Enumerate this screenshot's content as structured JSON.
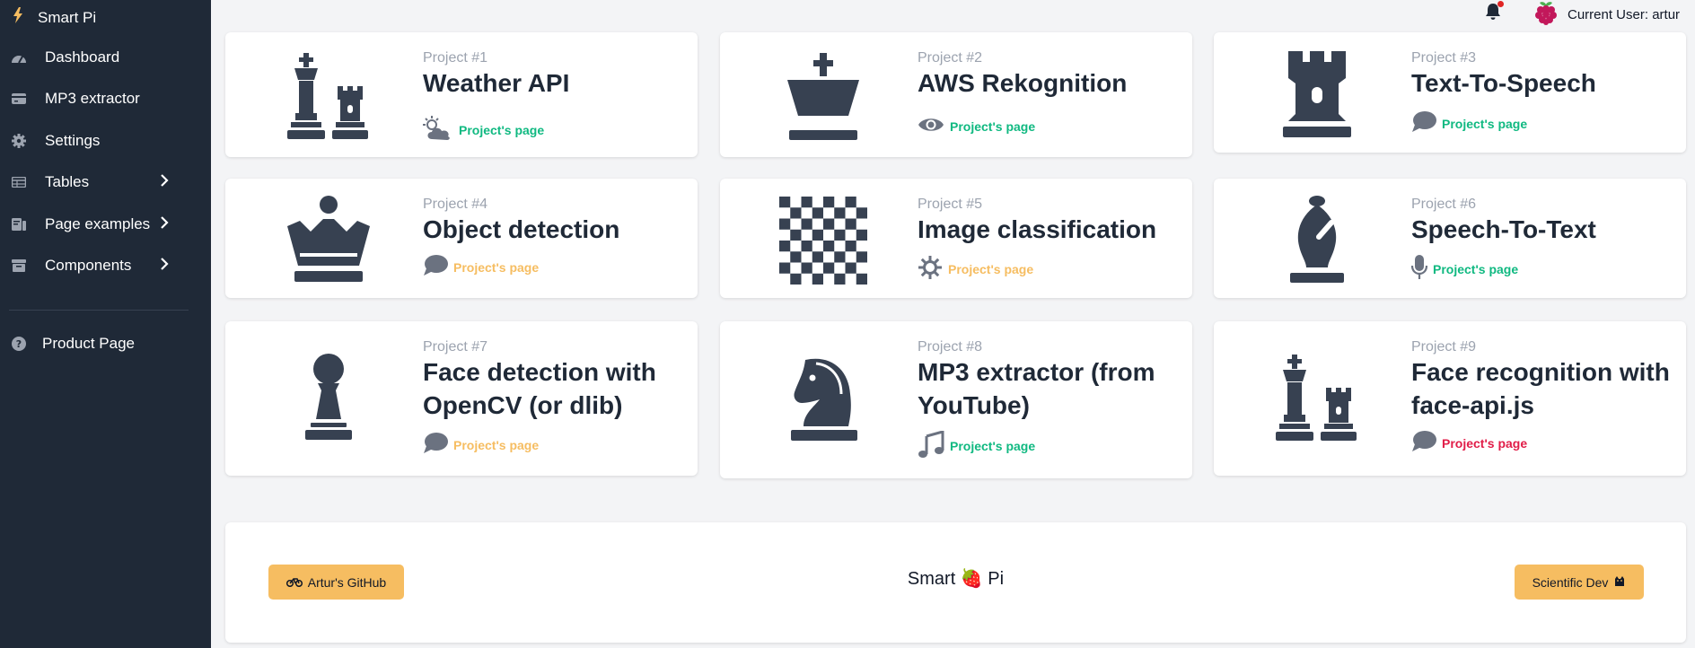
{
  "app": {
    "title": "Smart Pi"
  },
  "sidebar": {
    "items": [
      {
        "label": "Dashboard",
        "icon": "dashboard-icon"
      },
      {
        "label": "MP3 extractor",
        "icon": "card-icon"
      },
      {
        "label": "Settings",
        "icon": "gear-icon"
      },
      {
        "label": "Tables",
        "icon": "table-icon",
        "expandable": true
      },
      {
        "label": "Page examples",
        "icon": "pages-icon",
        "expandable": true
      },
      {
        "label": "Components",
        "icon": "archive-icon",
        "expandable": true
      }
    ],
    "bottom": {
      "label": "Product Page",
      "icon": "question-icon"
    }
  },
  "header": {
    "user_label": "Current User: artur",
    "notifications": true
  },
  "projects": [
    {
      "num": "Project #1",
      "title": "Weather API",
      "link": "Project's page",
      "link_color": "#10b981",
      "piece": "king-rook-icon",
      "link_icon": "sun-cloud-icon"
    },
    {
      "num": "Project #2",
      "title": "AWS Rekognition",
      "link": "Project's page",
      "link_color": "#10b981",
      "piece": "king-icon",
      "link_icon": "eye-icon"
    },
    {
      "num": "Project #3",
      "title": "Text-To-Speech",
      "link": "Project's page",
      "link_color": "#10b981",
      "piece": "rook-icon",
      "link_icon": "speech-bubble-icon"
    },
    {
      "num": "Project #4",
      "title": "Object detection",
      "link": "Project's page",
      "link_color": "#f6bd61",
      "piece": "queen-icon",
      "link_icon": "speech-bubble-icon"
    },
    {
      "num": "Project #5",
      "title": "Image classification",
      "link": "Project's page",
      "link_color": "#f6bd61",
      "piece": "chessboard-icon",
      "link_icon": "sun-icon"
    },
    {
      "num": "Project #6",
      "title": "Speech-To-Text",
      "link": "Project's page",
      "link_color": "#10b981",
      "piece": "bishop-icon",
      "link_icon": "microphone-icon"
    },
    {
      "num": "Project #7",
      "title": "Face detection with OpenCV (or dlib)",
      "link": "Project's page",
      "link_color": "#f6bd61",
      "piece": "pawn-icon",
      "link_icon": "speech-bubble-icon"
    },
    {
      "num": "Project #8",
      "title": "MP3 extractor (from YouTube)",
      "link": "Project's page",
      "link_color": "#10b981",
      "piece": "knight-icon",
      "link_icon": "music-note-icon"
    },
    {
      "num": "Project #9",
      "title": "Face recognition with face-api.js",
      "link": "Project's page",
      "link_color": "#e11d48",
      "piece": "king-rook-icon",
      "link_icon": "speech-bubble-icon"
    }
  ],
  "footer": {
    "left_button": "Artur's GitHub",
    "center_text": "Smart 🍓 Pi",
    "right_button": "Scientific Dev"
  },
  "colors": {
    "sidebar_bg": "#1f2937",
    "accent": "#f6bd61",
    "green": "#10b981",
    "red": "#e11d48"
  }
}
